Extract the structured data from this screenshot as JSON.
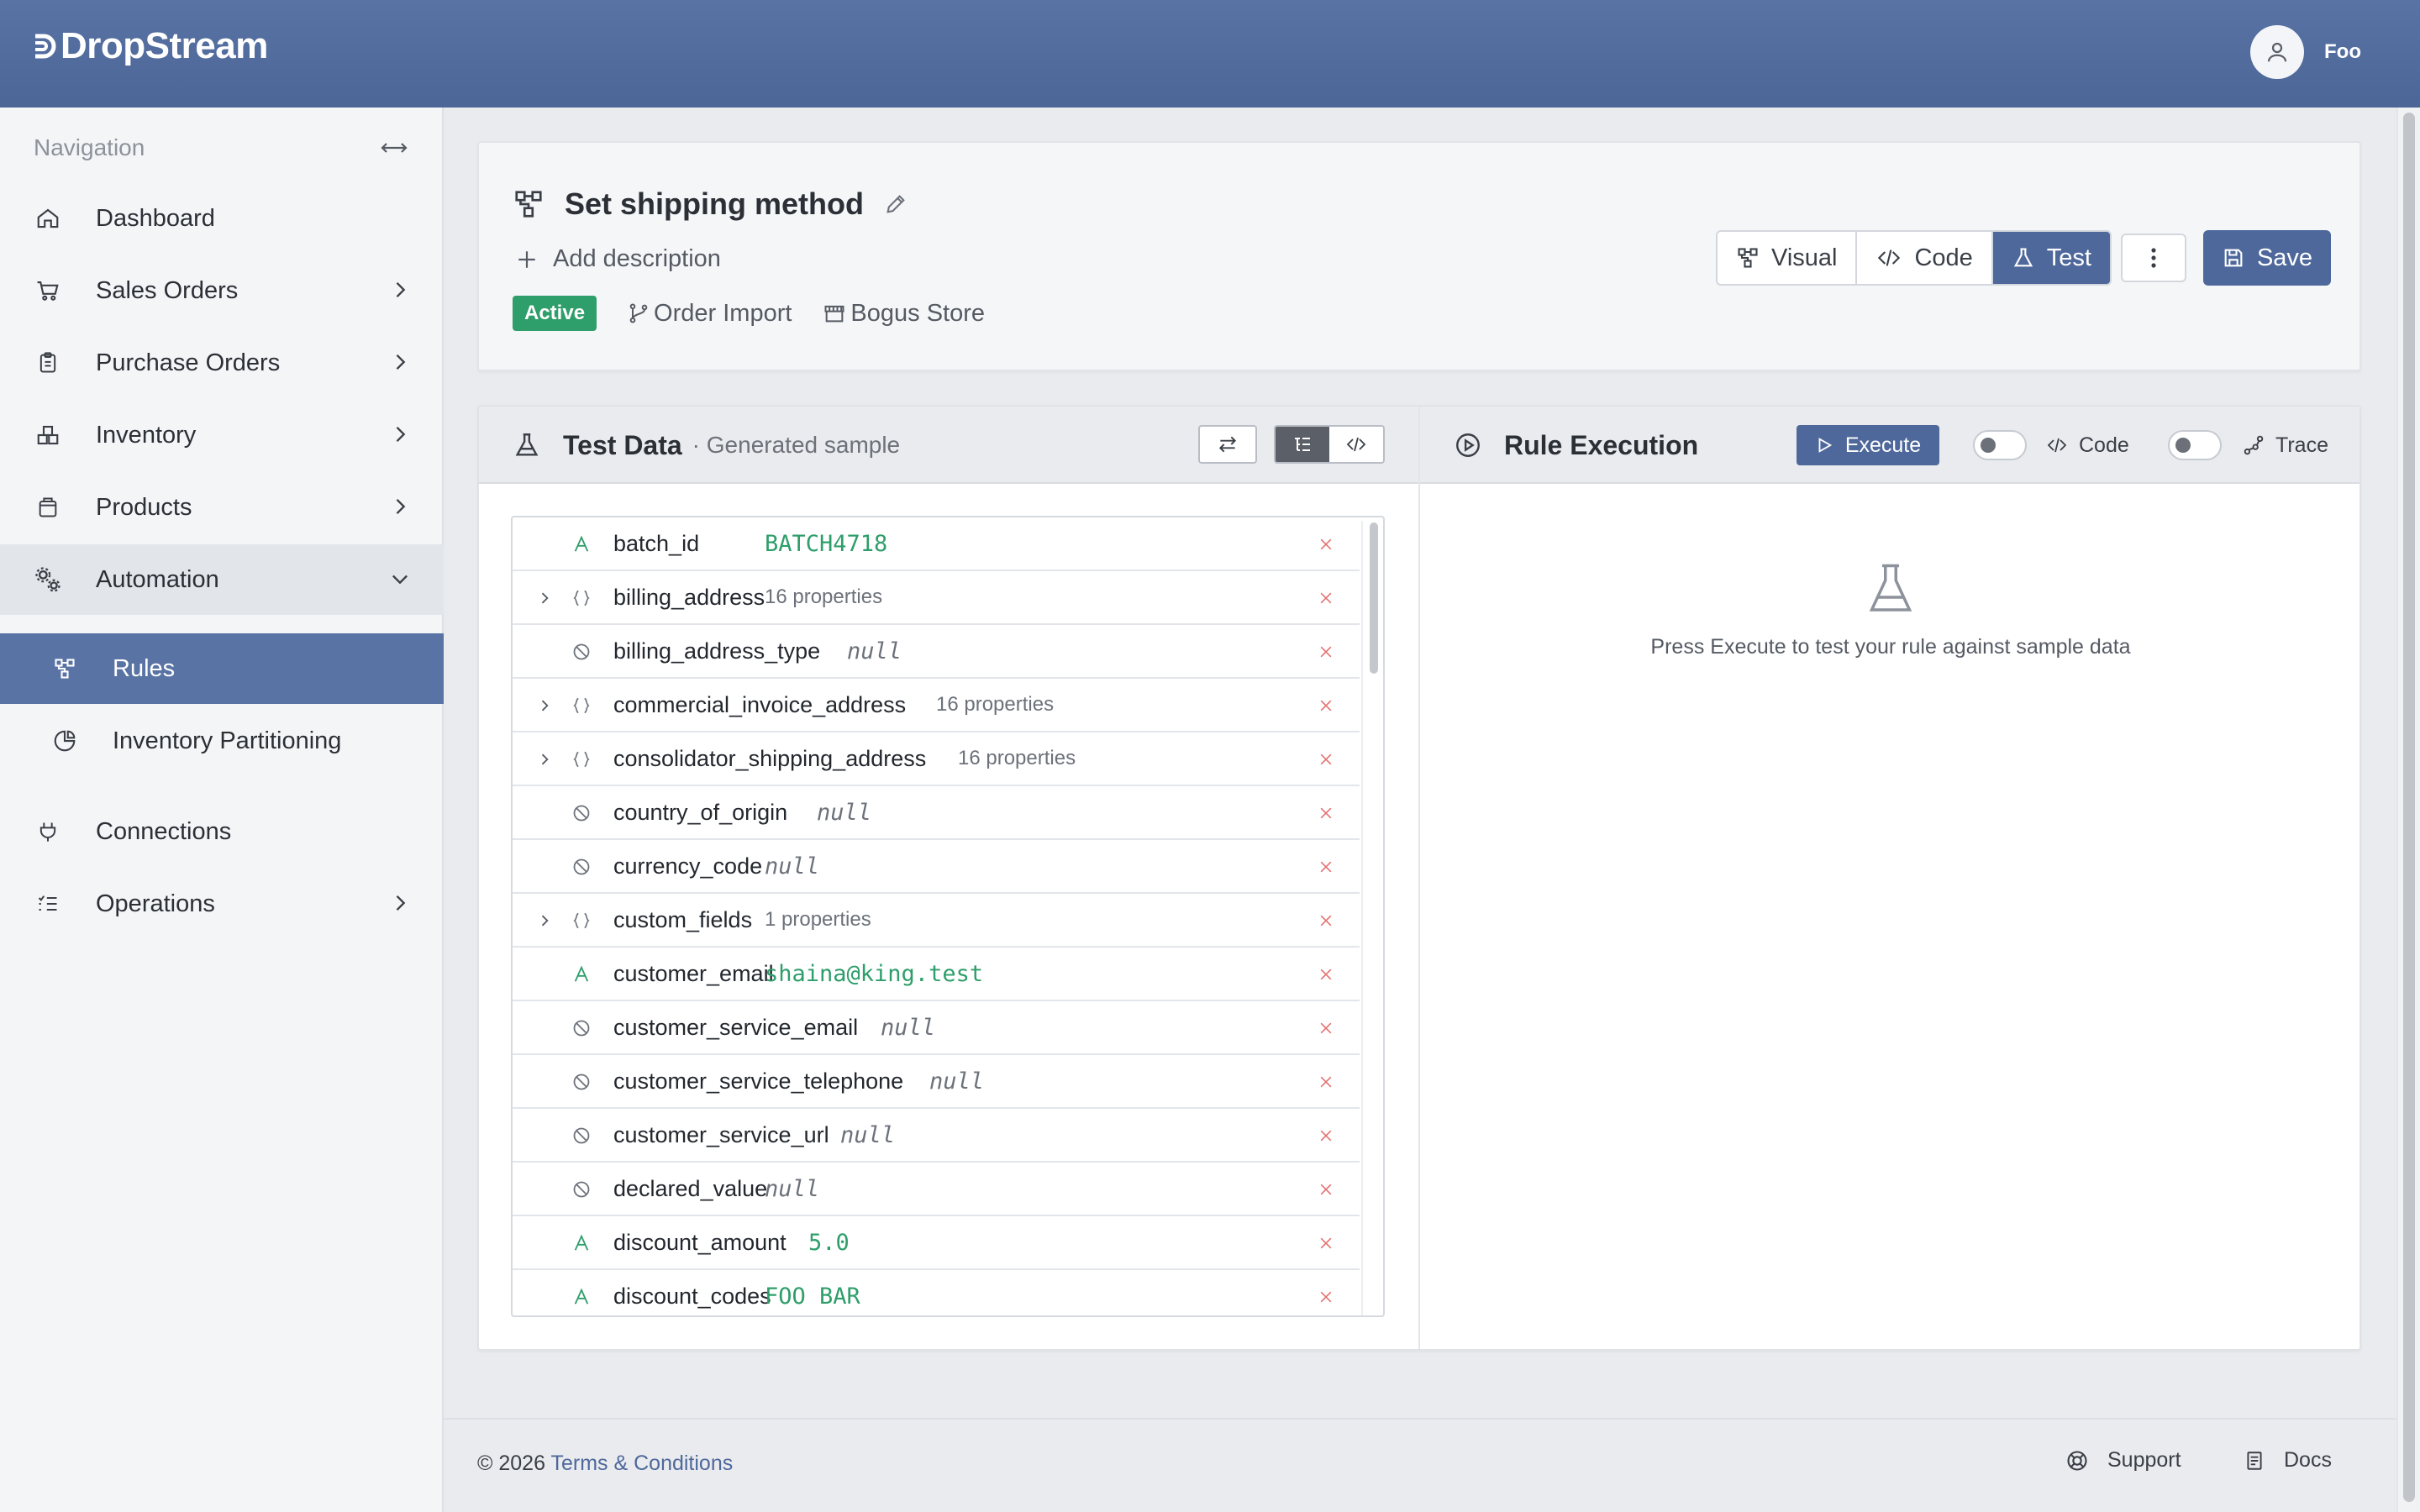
{
  "app": {
    "name": "DropStream",
    "user": "Foo"
  },
  "sidebar": {
    "heading": "Navigation",
    "items": [
      {
        "label": "Dashboard",
        "icon": "home-icon"
      },
      {
        "label": "Sales Orders",
        "icon": "cart-icon"
      },
      {
        "label": "Purchase Orders",
        "icon": "clipboard-icon"
      },
      {
        "label": "Inventory",
        "icon": "boxes-icon"
      },
      {
        "label": "Products",
        "icon": "package-icon"
      },
      {
        "label": "Automation",
        "icon": "cogs-icon",
        "expanded": true
      },
      {
        "label": "Rules",
        "icon": "workflow-icon",
        "active": true
      },
      {
        "label": "Inventory Partitioning",
        "icon": "pie-chart-icon"
      },
      {
        "label": "Connections",
        "icon": "plug-icon"
      },
      {
        "label": "Operations",
        "icon": "list-icon"
      }
    ]
  },
  "rule": {
    "title": "Set shipping method",
    "add_description": "Add description",
    "status": "Active",
    "source": "Order Import",
    "store": "Bogus Store",
    "views": [
      "Visual",
      "Code",
      "Test"
    ],
    "active_view": "Test",
    "save_label": "Save"
  },
  "test_data": {
    "title": "Test Data",
    "subtitle": "· Generated sample",
    "rows": [
      {
        "key": "batch_id",
        "type": "string",
        "value": "BATCH4718"
      },
      {
        "key": "billing_address",
        "type": "object",
        "value": "16 properties"
      },
      {
        "key": "billing_address_type",
        "type": "null",
        "value": "null"
      },
      {
        "key": "commercial_invoice_address",
        "type": "object",
        "value": "16 properties"
      },
      {
        "key": "consolidator_shipping_address",
        "type": "object",
        "value": "16 properties"
      },
      {
        "key": "country_of_origin",
        "type": "null",
        "value": "null"
      },
      {
        "key": "currency_code",
        "type": "null",
        "value": "null"
      },
      {
        "key": "custom_fields",
        "type": "object",
        "value": "1 properties"
      },
      {
        "key": "customer_email",
        "type": "string",
        "value": "shaina@king.test"
      },
      {
        "key": "customer_service_email",
        "type": "null",
        "value": "null"
      },
      {
        "key": "customer_service_telephone",
        "type": "null",
        "value": "null"
      },
      {
        "key": "customer_service_url",
        "type": "null",
        "value": "null"
      },
      {
        "key": "declared_value",
        "type": "null",
        "value": "null"
      },
      {
        "key": "discount_amount",
        "type": "string",
        "value": "5.0"
      },
      {
        "key": "discount_codes",
        "type": "string",
        "value": "FOO BAR"
      }
    ]
  },
  "execution": {
    "title": "Rule Execution",
    "execute_label": "Execute",
    "code_label": "Code",
    "trace_label": "Trace",
    "empty_message": "Press Execute to test your rule against sample data"
  },
  "footer": {
    "copyright": "© 2026",
    "terms": "Terms & Conditions",
    "support": "Support",
    "docs": "Docs"
  },
  "colors": {
    "brand": "#4e689b",
    "success": "#2e9e6a",
    "danger": "#e57373"
  }
}
